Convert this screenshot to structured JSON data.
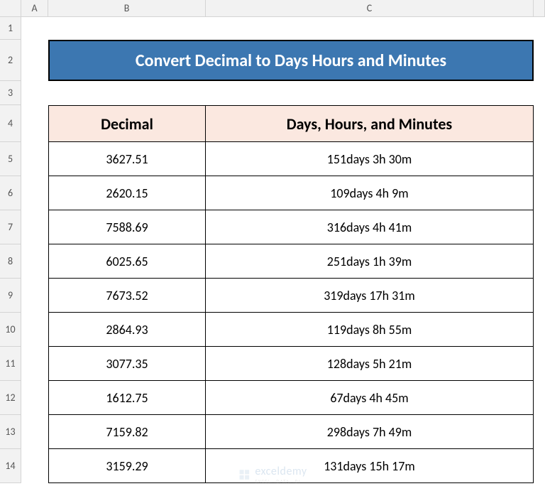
{
  "columns": [
    "",
    "A",
    "B",
    "C",
    ""
  ],
  "rows": [
    "1",
    "2",
    "3",
    "4",
    "5",
    "6",
    "7",
    "8",
    "9",
    "10",
    "11",
    "12",
    "13",
    "14"
  ],
  "title": "Convert Decimal to Days Hours and Minutes",
  "headers": {
    "decimal": "Decimal",
    "dhm": "Days, Hours, and Minutes"
  },
  "data": [
    {
      "decimal": "3627.51",
      "dhm": "151days   3h   30m"
    },
    {
      "decimal": "2620.15",
      "dhm": "109days   4h   9m"
    },
    {
      "decimal": "7588.69",
      "dhm": "316days   4h   41m"
    },
    {
      "decimal": "6025.65",
      "dhm": "251days   1h   39m"
    },
    {
      "decimal": "7673.52",
      "dhm": "319days   17h   31m"
    },
    {
      "decimal": "2864.93",
      "dhm": "119days   8h   55m"
    },
    {
      "decimal": "3077.35",
      "dhm": "128days   5h   21m"
    },
    {
      "decimal": "1612.75",
      "dhm": "67days   4h   45m"
    },
    {
      "decimal": "7159.82",
      "dhm": "298days   7h   49m"
    },
    {
      "decimal": "3159.29",
      "dhm": "131days   15h   17m"
    }
  ],
  "watermark": {
    "main": "exceldemy",
    "sub": "EXCEL · DATA · BI"
  }
}
